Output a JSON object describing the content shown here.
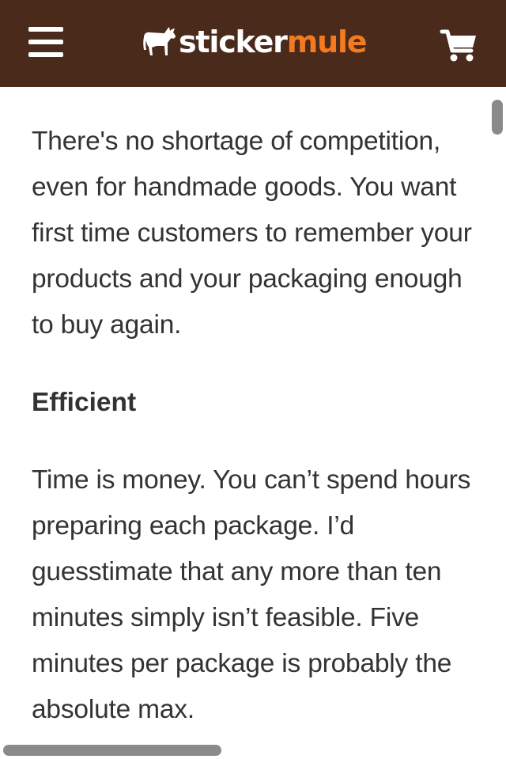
{
  "header": {
    "logo_part_1": "sticker",
    "logo_part_2": "mule",
    "colors": {
      "background": "#4a2a1b",
      "logo_white": "#ffffff",
      "logo_orange": "#f47a20"
    },
    "icons": {
      "menu": "hamburger-menu-icon",
      "logo": "mule-icon",
      "cart": "shopping-cart-icon"
    }
  },
  "article": {
    "paragraph_1": "There's no shortage of competition, even for handmade goods. You want first time customers to remember your products and your packaging enough to buy again.",
    "heading_1": "Efficient",
    "paragraph_2": "Time is money. You can’t spend hours preparing each package. I’d guesstimate that any more than ten minutes simply isn’t feasible. Five minutes per package is probably the absolute max."
  }
}
